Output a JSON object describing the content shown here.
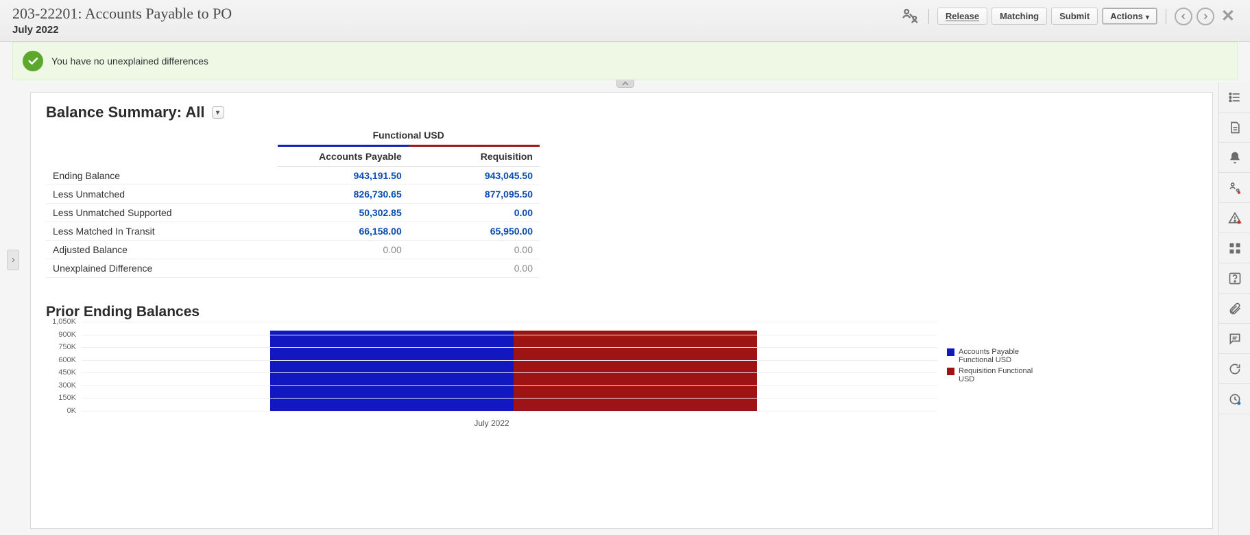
{
  "header": {
    "title": "203-22201: Accounts Payable to PO",
    "period": "July 2022",
    "buttons": {
      "release": "Release",
      "matching": "Matching",
      "submit": "Submit",
      "actions": "Actions"
    }
  },
  "banner": {
    "message": "You have no unexplained differences"
  },
  "summary": {
    "title": "Balance Summary: All",
    "currency_header": "Functional USD",
    "col1": "Accounts Payable",
    "col2": "Requisition",
    "rows": [
      {
        "label": "Ending Balance",
        "indent": false,
        "ap": "943,191.50",
        "rq": "943,045.50",
        "link": true
      },
      {
        "label": "Less Unmatched",
        "indent": true,
        "ap": "826,730.65",
        "rq": "877,095.50",
        "link": true
      },
      {
        "label": "Less Unmatched Supported",
        "indent": true,
        "ap": "50,302.85",
        "rq": "0.00",
        "link": true
      },
      {
        "label": "Less Matched In Transit",
        "indent": true,
        "ap": "66,158.00",
        "rq": "65,950.00",
        "link": true
      },
      {
        "label": "Adjusted Balance",
        "indent": false,
        "ap": "0.00",
        "rq": "0.00",
        "link": false
      },
      {
        "label": "Unexplained Difference",
        "indent": false,
        "ap": "",
        "rq": "0.00",
        "link": false
      }
    ]
  },
  "chart_data": {
    "type": "bar",
    "title": "Prior Ending Balances",
    "categories": [
      "July 2022"
    ],
    "ylim": [
      0,
      1050000
    ],
    "y_ticks": [
      "1,050K",
      "900K",
      "750K",
      "600K",
      "450K",
      "300K",
      "150K",
      "0K"
    ],
    "series": [
      {
        "name": "Accounts Payable Functional USD",
        "color": "#1218c0",
        "values": [
          943191.5
        ]
      },
      {
        "name": "Requisition Functional USD",
        "color": "#9e1313",
        "values": [
          943045.5
        ]
      }
    ],
    "x_label": "July 2022"
  },
  "rail_icons": [
    "list-icon",
    "document-icon",
    "bell-icon",
    "user-hierarchy-icon",
    "alert-icon",
    "apps-icon",
    "help-icon",
    "attachment-icon",
    "comment-icon",
    "refresh-icon",
    "schedule-icon"
  ]
}
